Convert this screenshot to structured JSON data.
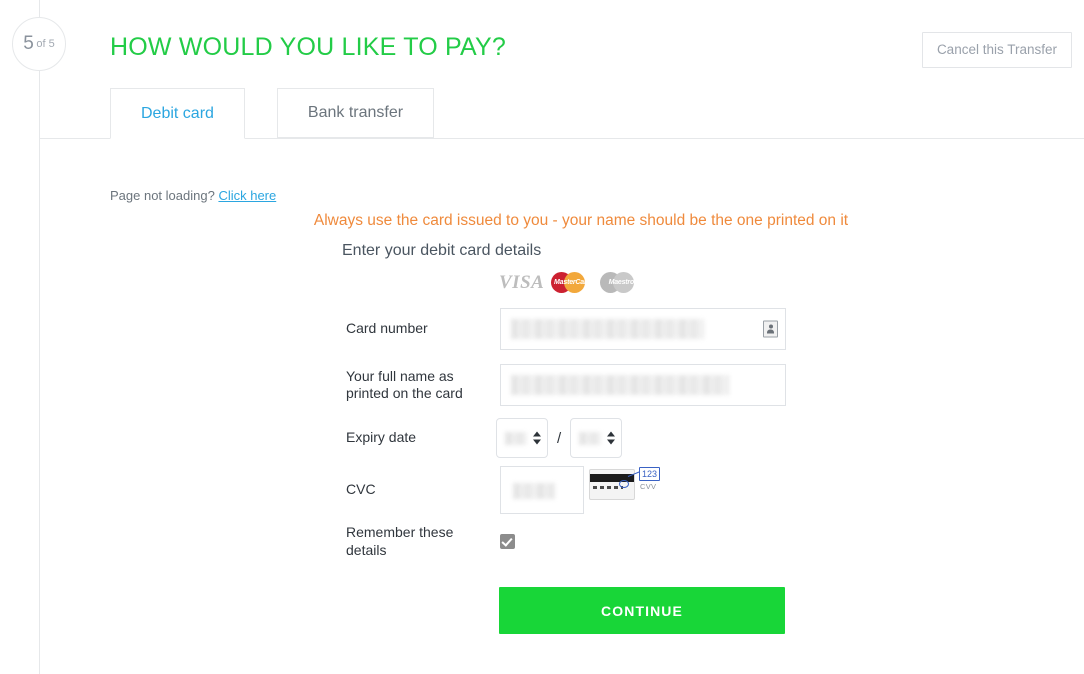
{
  "step": {
    "current": "5",
    "of_label": "of",
    "total": "5"
  },
  "header": {
    "title": "HOW WOULD YOU LIKE TO PAY?",
    "title_color": "#23cc47",
    "cancel_label": "Cancel this Transfer"
  },
  "tabs": [
    {
      "label": "Debit card",
      "active": true
    },
    {
      "label": "Bank transfer",
      "active": false
    }
  ],
  "notice": {
    "page_not_loading_text": "Page not loading?",
    "click_here_label": "Click here",
    "card_warning": "Always use the card issued to you - your name should be the one printed on it",
    "warning_color": "#ef8a3c"
  },
  "form": {
    "heading": "Enter your debit card details",
    "card_logos": [
      {
        "name": "VISA",
        "type": "visa"
      },
      {
        "name": "MasterCard",
        "type": "mastercard"
      },
      {
        "name": "Maestro",
        "type": "maestro"
      }
    ],
    "fields": {
      "card_number": {
        "label": "Card number",
        "value": "",
        "placeholder": "",
        "redacted": true
      },
      "full_name": {
        "label": "Your full name as printed on the card",
        "label_line1": "Your full name as",
        "label_line2": "printed on the card",
        "value": "",
        "placeholder": "",
        "redacted": true
      },
      "expiry": {
        "label": "Expiry date",
        "separator": "/",
        "month_value": "",
        "year_value": "",
        "redacted": true
      },
      "cvc": {
        "label": "CVC",
        "value": "",
        "redacted": true
      },
      "remember": {
        "label_line1": "Remember these",
        "label_line2": "details",
        "checked": true
      }
    },
    "cvv_hint": {
      "number": "123",
      "caption": "CVV"
    },
    "submit_label": "CONTINUE",
    "submit_color": "#18d638"
  }
}
